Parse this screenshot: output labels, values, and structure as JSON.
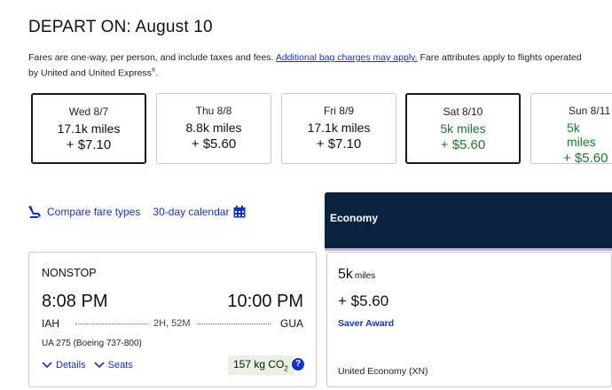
{
  "header": {
    "title": "DEPART ON: August 10"
  },
  "notice": {
    "text_before": "Fares are one-way, per person, and include taxes and fees. ",
    "link_text": "Additional bag charges may apply.",
    "text_after": " Fare attributes apply to flights operated by United and United Express",
    "superscript": "®",
    "end": "."
  },
  "dates": [
    {
      "day": "Wed 8/7",
      "miles": "17.1k miles",
      "price": "+ $7.10",
      "highlight": false,
      "selected": true
    },
    {
      "day": "Thu 8/8",
      "miles": "8.8k miles",
      "price": "+ $5.60",
      "highlight": false,
      "selected": false
    },
    {
      "day": "Fri 8/9",
      "miles": "17.1k miles",
      "price": "+ $7.10",
      "highlight": false,
      "selected": false
    },
    {
      "day": "Sat 8/10",
      "miles": "5k miles",
      "price": "+ $5.60",
      "highlight": true,
      "selected": true
    },
    {
      "day": "Sun 8/11",
      "miles": "5k miles",
      "price": "+ $5.60",
      "highlight": true,
      "selected": false
    }
  ],
  "tools": {
    "compare_label": "Compare fare types",
    "calendar_label": "30-day calendar"
  },
  "fare_header": {
    "label": "Economy"
  },
  "flight": {
    "stops": "NONSTOP",
    "depart_time": "8:08 PM",
    "arrive_time": "10:00 PM",
    "origin": "IAH",
    "destination": "GUA",
    "duration": "2H, 52M",
    "flight_info": "UA 275 (Boeing 737-800)",
    "details_label": "Details",
    "seats_label": "Seats",
    "co2_value": "157 kg CO",
    "co2_sub": "2",
    "info_glyph": "?"
  },
  "fare": {
    "miles_value": "5k",
    "miles_unit": "miles",
    "price": "+ $5.60",
    "award_type": "Saver Award",
    "cabin_class": "United Economy (XN)"
  },
  "colors": {
    "link_blue": "#1432c8",
    "fare_green": "#1a7a2e",
    "header_navy": "#0c2340"
  }
}
